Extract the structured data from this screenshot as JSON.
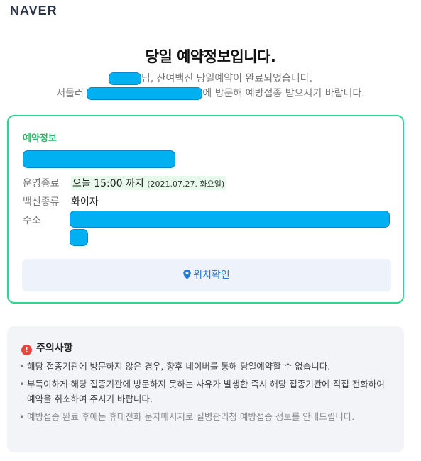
{
  "header": {
    "logo": "NAVER"
  },
  "main": {
    "title": "당일 예약정보입니다.",
    "message_line1_suffix": "님, 잔여백신 당일예약이 완료되었습니다.",
    "message_line2_prefix": "서둘러 ",
    "message_line2_suffix": "에 방문해 예방접종 받으시기 바랍니다."
  },
  "reservation": {
    "section_label": "예약정보",
    "hours_label": "운영종료",
    "hours_value": "오늘 15:00 까지",
    "hours_date": "(2021.07.27. 화요일)",
    "vaccine_label": "백신종류",
    "vaccine_value": "화이자",
    "address_label": "주소",
    "location_button": "위치확인"
  },
  "notice": {
    "title": "주의사항",
    "items": [
      "해당 접종기관에 방문하지 않은 경우, 향후 네이버를 통해 당일예약할 수 없습니다.",
      "부득이하게 해당 접종기관에 방문하지 못하는 사유가 발생한 즉시 해당 접종기관에 직접 전화하여 예약을 취소하여 주시기 바랍니다.",
      "예방접종 완료 후에는 휴대전화 문자메시지로 질병관리청 예방접종 정보를 안내드립니다."
    ]
  },
  "colors": {
    "accent_green": "#2fd48e",
    "link_blue": "#1e7be0",
    "redaction": "#00b0f0",
    "warning_red": "#e8453c"
  },
  "icons": {
    "location": "map-pin-icon",
    "warning": "exclamation-circle-icon"
  }
}
